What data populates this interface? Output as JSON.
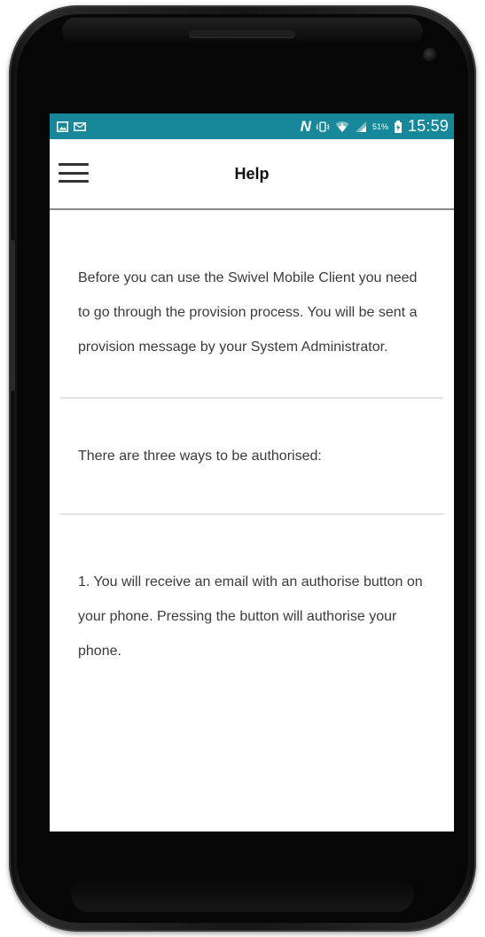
{
  "status_bar": {
    "left_icons": [
      "image-notification-icon",
      "mail-notification-icon"
    ],
    "nfc_label": "N",
    "right_icons": [
      "vibrate-icon",
      "wifi-icon",
      "signal-icon"
    ],
    "battery_percent": "51%",
    "time": "15:59",
    "background_color": "#16889a"
  },
  "app_bar": {
    "title": "Help",
    "menu_icon": "hamburger-menu-icon"
  },
  "help": {
    "intro": "Before you can use the Swivel Mobile Client you need to go through the provision process. You will be sent a provision message by your System Administrator.",
    "ways_heading": "There are three ways to be authorised:",
    "way_1": "1. You will receive an email with an authorise button on your phone. Pressing the button will authorise your phone."
  }
}
